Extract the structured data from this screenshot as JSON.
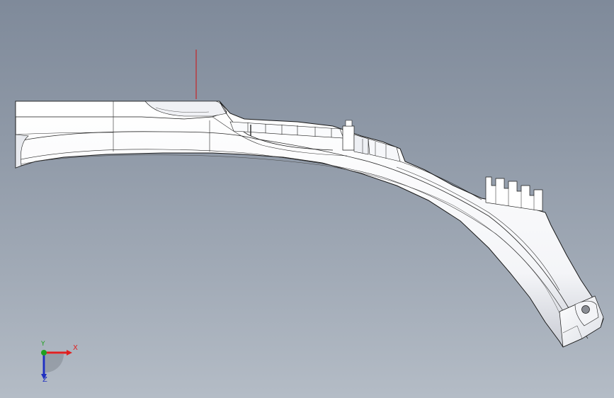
{
  "viewport": {
    "background_top": "#7f8a9a",
    "background_bottom": "#b4bcc6",
    "part_color": "#ffffff",
    "edge_color": "#1a1a1a",
    "origin_line_color": "#d01010"
  },
  "triad": {
    "x_label": "X",
    "y_label": "Y",
    "z_label": "Z",
    "x_color": "#e02020",
    "y_color": "#20a020",
    "z_color": "#2030c0"
  }
}
